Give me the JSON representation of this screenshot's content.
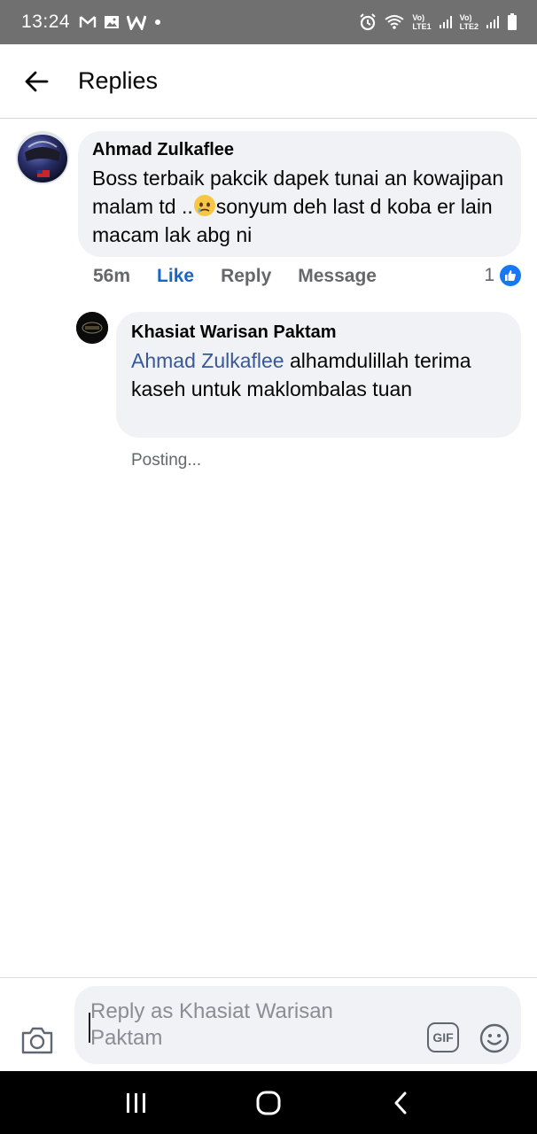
{
  "status_bar": {
    "time": "13:24",
    "left_icons": [
      "gmail-icon",
      "gallery-icon",
      "w-app-icon",
      "dot-icon"
    ],
    "right_icons": [
      "alarm-icon",
      "wifi-icon",
      "signal-lte1-icon",
      "signal-lte2-icon",
      "battery-icon"
    ],
    "net1": "LTE1",
    "net2": "LTE2"
  },
  "header": {
    "title": "Replies"
  },
  "comment": {
    "author": "Ahmad Zulkaflee",
    "text_before_emoji": "Boss terbaik pakcik dapek tunai an kowajipan malam td ..",
    "text_after_emoji": "sonyum deh last d koba er lain macam lak abg ni",
    "emoji": "face-holding-back-tears-emoji",
    "timestamp": "56m",
    "like_label": "Like",
    "reply_label": "Reply",
    "message_label": "Message",
    "like_count": "1"
  },
  "reply": {
    "author": "Khasiat Warisan Paktam",
    "mention": "Ahmad Zulkaflee",
    "text": " alhamdulillah terima kaseh untuk maklombalas tuan",
    "status": "Posting..."
  },
  "composer": {
    "placeholder": "Reply as Khasiat Warisan Paktam",
    "gif_label": "GIF"
  },
  "colors": {
    "status_bar": "#707070",
    "bubble": "#f0f2f5",
    "like_blue": "#1a66c8",
    "mention": "#385898",
    "secondary_text": "#65676b"
  }
}
